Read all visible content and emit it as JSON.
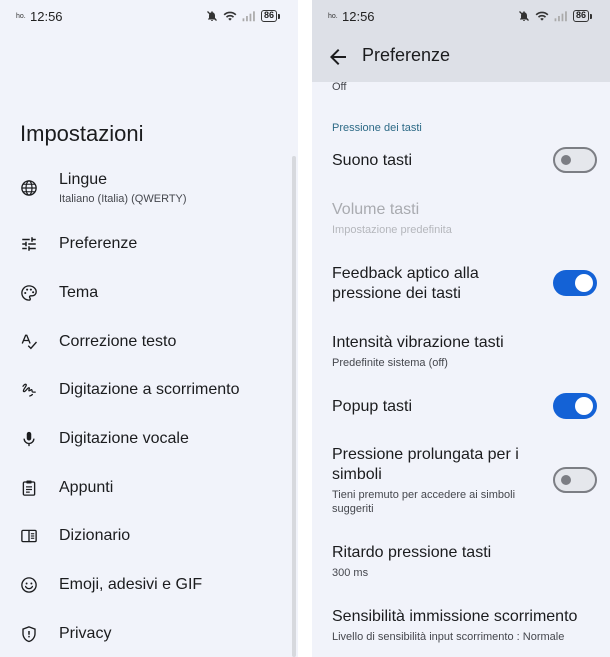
{
  "status_bar": {
    "carrier": "ho.",
    "time": "12:56",
    "battery": "86",
    "icons": [
      "bell-off-icon",
      "wifi-icon",
      "signal-icon",
      "battery-icon"
    ]
  },
  "left": {
    "title": "Impostazioni",
    "items": [
      {
        "label": "Lingue",
        "sub": "Italiano (Italia) (QWERTY)",
        "icon": "globe-icon"
      },
      {
        "label": "Preferenze",
        "icon": "tune-icon"
      },
      {
        "label": "Tema",
        "icon": "palette-icon"
      },
      {
        "label": "Correzione testo",
        "icon": "spellcheck-icon"
      },
      {
        "label": "Digitazione a scorrimento",
        "icon": "gesture-icon"
      },
      {
        "label": "Digitazione vocale",
        "icon": "mic-icon"
      },
      {
        "label": "Appunti",
        "icon": "clipboard-icon"
      },
      {
        "label": "Dizionario",
        "icon": "book-icon"
      },
      {
        "label": "Emoji, adesivi e GIF",
        "icon": "emoji-icon"
      },
      {
        "label": "Privacy",
        "icon": "shield-icon"
      }
    ]
  },
  "right": {
    "title": "Preferenze",
    "prev_value": "Off",
    "section": "Pressione dei tasti",
    "prefs": [
      {
        "title": "Suono tasti",
        "toggle": "off"
      },
      {
        "title": "Volume tasti",
        "sub": "Impostazione predefinita",
        "disabled": true
      },
      {
        "title": "Feedback aptico alla pressione dei tasti",
        "toggle": "on"
      },
      {
        "title": "Intensità vibrazione tasti",
        "sub": "Predefinite sistema (off)"
      },
      {
        "title": "Popup tasti",
        "toggle": "on"
      },
      {
        "title": "Pressione prolungata per i simboli",
        "sub": "Tieni premuto per accedere ai simboli suggeriti",
        "toggle": "off"
      },
      {
        "title": "Ritardo pressione tasti",
        "sub": "300 ms"
      },
      {
        "title": "Sensibilità immissione scorrimento",
        "sub": "Livello di sensibilità input scorrimento : Normale"
      }
    ]
  }
}
